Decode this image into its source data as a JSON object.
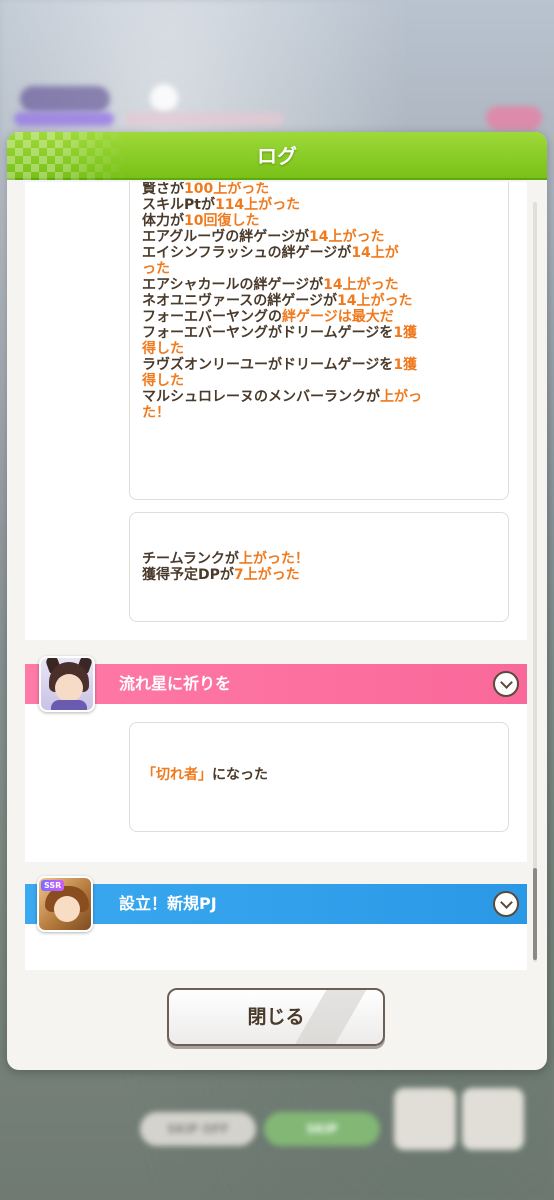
{
  "background": {
    "skip_label": "SKIP OFF",
    "fast_label": "SKIP"
  },
  "dialog": {
    "title": "ログ",
    "accent_color": "#7ac41a",
    "close_label": "閉じる"
  },
  "log_sections": {
    "first_card": {
      "lines": [
        [
          {
            "t": "賢さが",
            "h": false
          },
          {
            "t": "100上がった",
            "h": true
          }
        ],
        [
          {
            "t": "スキルPtが",
            "h": false
          },
          {
            "t": "114上がった",
            "h": true
          }
        ],
        [
          {
            "t": "体力が",
            "h": false
          },
          {
            "t": "10回復した",
            "h": true
          }
        ],
        [
          {
            "t": "エアグルーヴの絆ゲージが",
            "h": false
          },
          {
            "t": "14上がった",
            "h": true
          }
        ],
        [
          {
            "t": "エイシンフラッシュの絆ゲージが",
            "h": false
          },
          {
            "t": "14上が",
            "h": true
          }
        ],
        [
          {
            "t": "った",
            "h": true
          }
        ],
        [
          {
            "t": "エアシャカールの絆ゲージが",
            "h": false
          },
          {
            "t": "14上がった",
            "h": true
          }
        ],
        [
          {
            "t": "ネオユニヴァースの絆ゲージが",
            "h": false
          },
          {
            "t": "14上がった",
            "h": true
          }
        ],
        [
          {
            "t": "フォーエバーヤングの",
            "h": false
          },
          {
            "t": "絆ゲージは最大だ",
            "h": true
          }
        ],
        [
          {
            "t": "フォーエバーヤングがドリームゲージを",
            "h": false
          },
          {
            "t": "1獲",
            "h": true
          }
        ],
        [
          {
            "t": "得した",
            "h": true
          }
        ],
        [
          {
            "t": "ラヴズオンリーユーがドリームゲージを",
            "h": false
          },
          {
            "t": "1獲",
            "h": true
          }
        ],
        [
          {
            "t": "得した",
            "h": true
          }
        ],
        [
          {
            "t": "マルシュロレーヌのメンバーランクが",
            "h": false
          },
          {
            "t": "上がっ",
            "h": true
          }
        ],
        [
          {
            "t": "た！",
            "h": true
          }
        ]
      ]
    },
    "second_card": {
      "lines": [
        [
          {
            "t": "チームランクが",
            "h": false
          },
          {
            "t": "上がった！",
            "h": true
          }
        ],
        [
          {
            "t": "獲得予定DPが",
            "h": false
          },
          {
            "t": "7上がった",
            "h": true
          }
        ]
      ]
    },
    "event_1": {
      "title": "流れ星に祈りを",
      "banner_color": "#fb6f9e",
      "icon": "horse-girl-portrait",
      "lines": [
        [
          {
            "t": "「切れ者」",
            "h": true
          },
          {
            "t": "になった",
            "h": false
          }
        ]
      ]
    },
    "event_2": {
      "title": "設立！新規PJ",
      "banner_color": "#2f9ee9",
      "icon": "ssr-support-card-portrait",
      "badge": "SSR"
    }
  }
}
